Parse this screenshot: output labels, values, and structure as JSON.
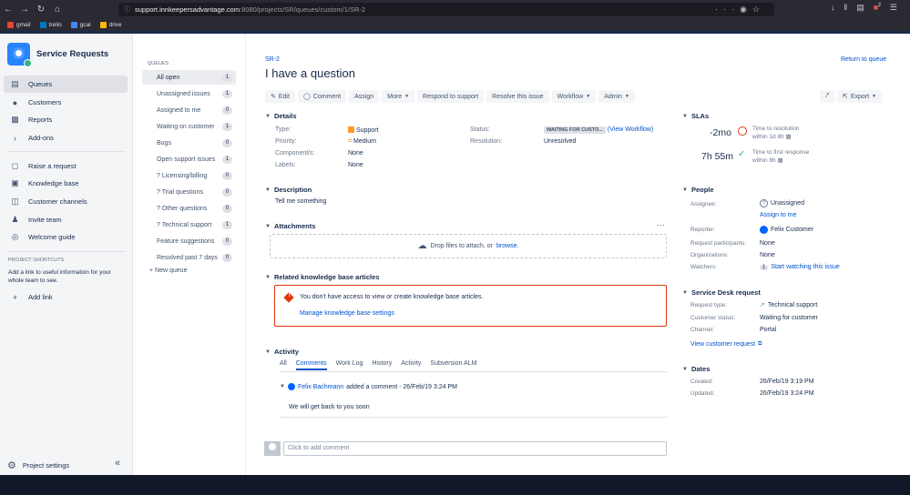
{
  "browser": {
    "url_host": "support.innkeepersadvantage.com",
    "url_path": ":8080/projects/SR/queues/custom/1/SR-2",
    "url_dots": "···",
    "bookmarks": [
      "gmail",
      "trello",
      "gcal",
      "drive"
    ],
    "notif_count": "2"
  },
  "sidebar": {
    "project_name": "Service Requests",
    "items": [
      {
        "label": "Queues",
        "icon": "queues-icon"
      },
      {
        "label": "Customers",
        "icon": "customers-icon"
      },
      {
        "label": "Reports",
        "icon": "reports-icon"
      },
      {
        "label": "Add-ons",
        "icon": "chevron-right-icon"
      },
      {
        "label": "Raise a request",
        "icon": "raise-request-icon"
      },
      {
        "label": "Knowledge base",
        "icon": "book-icon"
      },
      {
        "label": "Customer channels",
        "icon": "channels-icon"
      },
      {
        "label": "Invite team",
        "icon": "invite-icon"
      },
      {
        "label": "Welcome guide",
        "icon": "compass-icon"
      }
    ],
    "shortcuts_title": "PROJECT SHORTCUTS",
    "shortcuts_desc": "Add a link to useful information for your whole team to see.",
    "add_link": "Add link",
    "settings": "Project settings"
  },
  "queues": {
    "title": "QUEUES",
    "items": [
      {
        "label": "All open",
        "count": "1"
      },
      {
        "label": "Unassigned issues",
        "count": "1"
      },
      {
        "label": "Assigned to me",
        "count": "0"
      },
      {
        "label": "Waiting on customer",
        "count": "1"
      },
      {
        "label": "Bugs",
        "count": "0"
      },
      {
        "label": "Open support issues",
        "count": "1"
      },
      {
        "label": "? Licensing/billing",
        "count": "0"
      },
      {
        "label": "? Trial questions",
        "count": "0"
      },
      {
        "label": "? Other questions",
        "count": "0"
      },
      {
        "label": "? Technical support",
        "count": "1"
      },
      {
        "label": "Feature suggestions",
        "count": "0"
      },
      {
        "label": "Resolved past 7 days",
        "count": "0"
      }
    ],
    "new_queue": "New queue"
  },
  "issue": {
    "key": "SR-2",
    "title": "I have a question",
    "return_link": "Return to queue",
    "toolbar": {
      "edit": "Edit",
      "comment": "Comment",
      "assign": "Assign",
      "more": "More",
      "respond": "Respond to support",
      "resolve": "Resolve this issue",
      "workflow": "Workflow",
      "admin": "Admin",
      "export": "Export"
    },
    "details": {
      "heading": "Details",
      "type_label": "Type:",
      "type_value": "Support",
      "priority_label": "Priority:",
      "priority_value": "Medium",
      "components_label": "Component/s:",
      "components_value": "None",
      "labels_label": "Labels:",
      "labels_value": "None",
      "status_label": "Status:",
      "status_value": "WAITING FOR CUSTO...",
      "view_workflow": "(View Workflow)",
      "resolution_label": "Resolution:",
      "resolution_value": "Unresolved"
    },
    "description": {
      "heading": "Description",
      "text": "Tell me something"
    },
    "attachments": {
      "heading": "Attachments",
      "drop_text": "Drop files to attach, or",
      "browse": "browse."
    },
    "kb": {
      "heading": "Related knowledge base articles",
      "message": "You don't have access to view or create knowledge base articles.",
      "link": "Manage knowledge base settings"
    },
    "activity": {
      "heading": "Activity",
      "tabs": [
        "All",
        "Comments",
        "Work Log",
        "History",
        "Activity",
        "Subversion ALM"
      ],
      "active_tab": "Comments",
      "comment_author": "Felix Bachmann",
      "comment_meta": "added a comment - 26/Feb/19 3:24 PM",
      "comment_text": "We will get back to you soon",
      "add_placeholder": "Click to add comment"
    }
  },
  "right": {
    "slas_heading": "SLAs",
    "sla1_value": "-2mo",
    "sla1_label": "Time to resolution",
    "sla1_sub": "within 1d 8h",
    "sla2_value": "7h 55m",
    "sla2_label": "Time to first response",
    "sla2_sub": "within 8h",
    "people_heading": "People",
    "assignee_label": "Assignee:",
    "assignee_value": "Unassigned",
    "assign_to_me": "Assign to me",
    "reporter_label": "Reporter:",
    "reporter_value": "Felix Customer",
    "participants_label": "Request participants:",
    "participants_value": "None",
    "orgs_label": "Organizations:",
    "orgs_value": "None",
    "watchers_label": "Watchers:",
    "watchers_count": "1",
    "watchers_link": "Start watching this issue",
    "sd_heading": "Service Desk request",
    "req_type_label": "Request type:",
    "req_type_value": "Technical support",
    "cust_status_label": "Customer status:",
    "cust_status_value": "Waiting for customer",
    "channel_label": "Channel:",
    "channel_value": "Portal",
    "view_request": "View customer request",
    "dates_heading": "Dates",
    "created_label": "Created:",
    "created_value": "26/Feb/19 3:19 PM",
    "updated_label": "Updated:",
    "updated_value": "26/Feb/19 3:24 PM"
  }
}
